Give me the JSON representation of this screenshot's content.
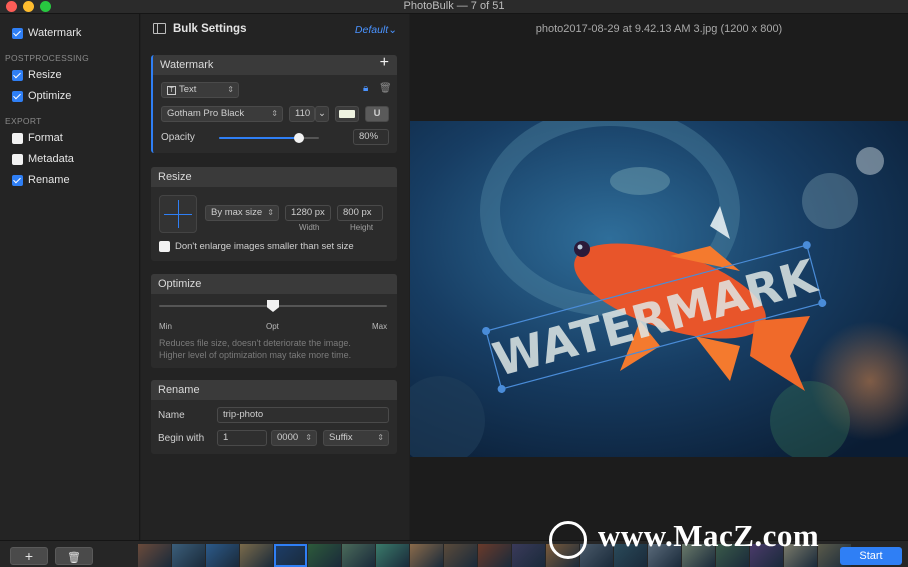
{
  "window": {
    "title": "PhotoBulk — 7 of 51"
  },
  "sidebar": {
    "items": [
      {
        "label": "Watermark",
        "checked": true
      },
      {
        "label": "Resize",
        "checked": true
      },
      {
        "label": "Optimize",
        "checked": true
      },
      {
        "label": "Format",
        "checked": false
      },
      {
        "label": "Metadata",
        "checked": false
      },
      {
        "label": "Rename",
        "checked": true
      }
    ],
    "sections": {
      "postprocessing": "POSTPROCESSING",
      "export": "EXPORT"
    }
  },
  "settings": {
    "title": "Bulk Settings",
    "preset": "Default",
    "watermark": {
      "header": "Watermark",
      "type": "Text",
      "font": "Gotham Pro Black",
      "size": "110",
      "opacity_label": "Opacity",
      "opacity_value": "80%",
      "opacity_fraction": 0.8
    },
    "resize": {
      "header": "Resize",
      "mode": "By max size",
      "width": "1280 px",
      "width_label": "Width",
      "height": "800 px",
      "height_label": "Height",
      "dont_enlarge": "Don't enlarge images smaller than set size"
    },
    "optimize": {
      "header": "Optimize",
      "min": "Min",
      "opt": "Opt",
      "max": "Max",
      "level_fraction": 0.5,
      "desc1": "Reduces file size, doesn't deteriorate the image.",
      "desc2": "Higher level of optimization may take more time."
    },
    "rename": {
      "header": "Rename",
      "name_label": "Name",
      "name_value": "trip-photo",
      "begin_label": "Begin with",
      "begin_value": "1",
      "digits": "0000",
      "position": "Suffix"
    }
  },
  "preview": {
    "filename": "photo2017-08-29 at 9.42.13 AM 3.jpg (1200 x 800)",
    "watermark_text": "WATERMARK"
  },
  "bottom": {
    "add": "+",
    "start": "Start",
    "brand": "www.MacZ.com"
  },
  "colors": {
    "accent": "#2f7ff5",
    "preset": "#4a93ff",
    "fish": "#e8552a"
  }
}
